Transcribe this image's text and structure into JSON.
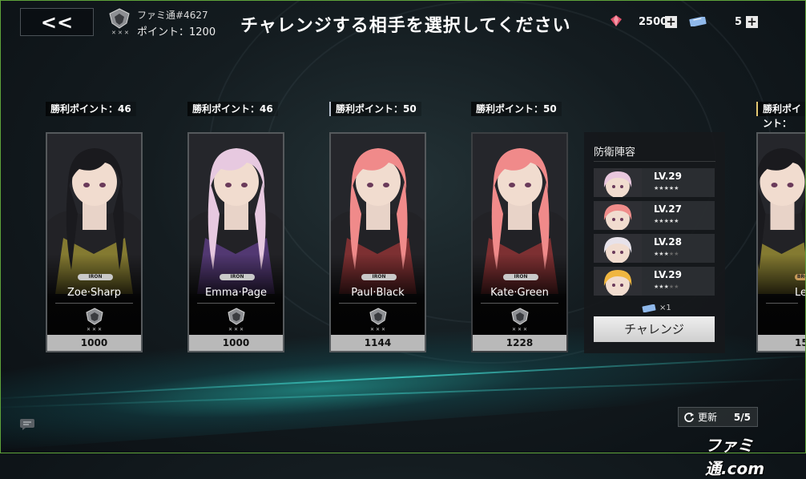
{
  "header": {
    "back_label": "<<",
    "player_name": "ファミ通#4627",
    "player_points": "ポイント：1200",
    "title": "チャレンジする相手を選択してください",
    "gem_count": "2500",
    "ticket_count": "5",
    "plus_label": "+"
  },
  "opponents": [
    {
      "vp": "勝利ポイント：46",
      "rank": "IRON",
      "name": "Zoe·Sharp",
      "score": "1000",
      "hair": "#1a1a1e",
      "accent": "#d6c23a"
    },
    {
      "vp": "勝利ポイント：46",
      "rank": "IRON",
      "name": "Emma·Page",
      "score": "1000",
      "hair": "#e7c9e0",
      "accent": "#7a4bb0"
    },
    {
      "vp": "勝利ポイント：50",
      "rank": "IRON",
      "name": "Paul·Black",
      "score": "1144",
      "hair": "#f08a8a",
      "accent": "#c83c3c"
    },
    {
      "vp": "勝利ポイント：50",
      "rank": "IRON",
      "name": "Kate·Green",
      "score": "1228",
      "hair": "#f08a8a",
      "accent": "#c83c3c"
    },
    {
      "vp": "勝利ポイント：",
      "rank": "BRO",
      "name": "Le",
      "score": "15",
      "hair": "#1a1a1e",
      "accent": "#d6c23a"
    }
  ],
  "defense": {
    "title": "防衛陣容",
    "units": [
      {
        "level": "LV.29",
        "stars": 5,
        "filled": 5,
        "color": "#e9c7dd"
      },
      {
        "level": "LV.27",
        "stars": 5,
        "filled": 5,
        "color": "#ef8c8a"
      },
      {
        "level": "LV.28",
        "stars": 5,
        "filled": 3,
        "color": "#e7e2ea"
      },
      {
        "level": "LV.29",
        "stars": 5,
        "filled": 3,
        "color": "#f0b640"
      }
    ],
    "cost": "×1",
    "challenge_label": "チャレンジ"
  },
  "footer": {
    "refresh_label": "更新",
    "refresh_count": "5/5",
    "watermark": "ファミ通.com"
  },
  "colors": {
    "gem": "#e0506a",
    "ticket": "#8fb8ea",
    "accent_teal": "#3fd6cc"
  }
}
